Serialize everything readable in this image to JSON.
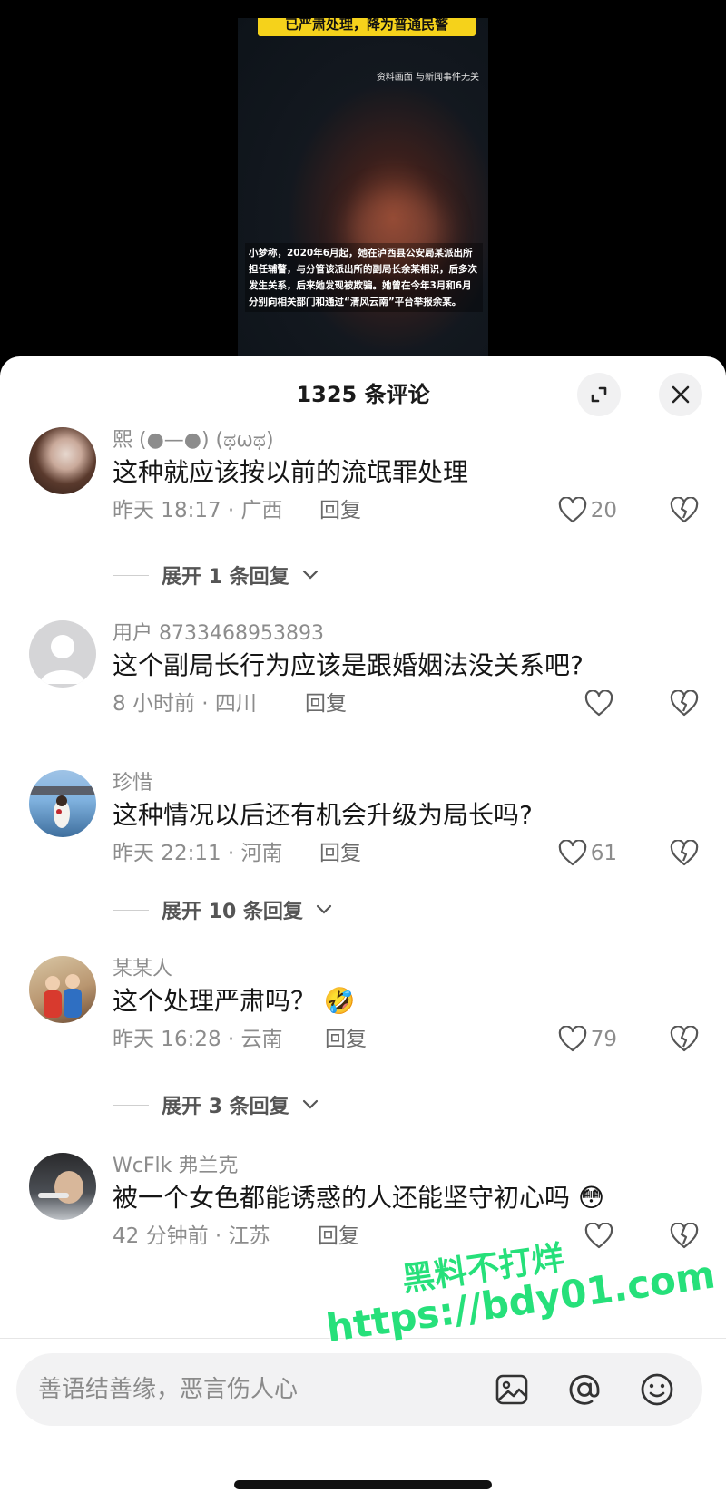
{
  "video": {
    "top_caption": "已严肃处理，降为普通民警",
    "disclaimer": "资料画面  与新闻事件无关",
    "body_caption": "小梦称，2020年6月起，她在泸西县公安局某派出所担任辅警，与分管该派出所的副局长余某相识，后多次发生关系，后来她发现被欺骗。她曾在今年3月和6月分别向相关部门和通过“清风云南”平台举报余某。"
  },
  "sheet": {
    "title": "1325 条评论",
    "expand_icon": "expand-icon",
    "close_icon": "close-icon"
  },
  "comments": [
    {
      "user": "熙 (●—●) (ಥωಥ)",
      "text": "这种就应该按以前的流氓罪处理",
      "time_location": "昨天 18:17 · 广西",
      "reply_label": "回复",
      "likes": "20"
    },
    {
      "user": "用户 8733468953893",
      "text": "这个副局长行为应该是跟婚姻法没关系吧?",
      "time_location": "8 小时前 · 四川",
      "reply_label": "回复",
      "likes": ""
    },
    {
      "user": "珍惜",
      "text": "这种情况以后还有机会升级为局长吗?",
      "time_location": "昨天 22:11 · 河南",
      "reply_label": "回复",
      "likes": "61"
    },
    {
      "user": "某某人",
      "text": "这个处理严肃吗？",
      "emoji": "🤣",
      "time_location": "昨天 16:28 · 云南",
      "reply_label": "回复",
      "likes": "79"
    },
    {
      "user": "WcFlk 弗兰克",
      "text": "被一个女色都能诱惑的人还能坚守初心吗",
      "emoji": "😳",
      "time_location": "42 分钟前 · 江苏",
      "reply_label": "回复",
      "likes": ""
    }
  ],
  "expand_replies": [
    "展开 1 条回复",
    "展开 10 条回复",
    "展开 3 条回复"
  ],
  "input": {
    "placeholder": "善语结善缘，恶言伤人心",
    "icons": [
      "image-icon",
      "at-icon",
      "emoji-icon"
    ]
  },
  "watermark": {
    "line1": "黑料不打烊",
    "line2": "https://bdy01.com"
  },
  "colors": {
    "caption_yellow": "#f5d21b",
    "watermark_green": "#26e07a"
  }
}
